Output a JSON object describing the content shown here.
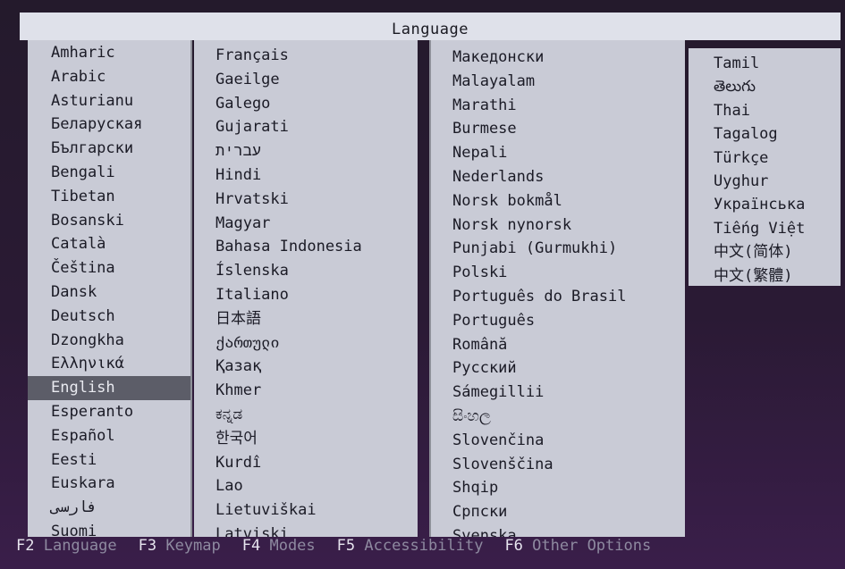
{
  "dialog": {
    "title": "Language"
  },
  "columns": [
    [
      "Amharic",
      "Arabic",
      "Asturianu",
      "Беларуская",
      "Български",
      "Bengali",
      "Tibetan",
      "Bosanski",
      "Català",
      "Čeština",
      "Dansk",
      "Deutsch",
      "Dzongkha",
      "Ελληνικά",
      "English",
      "Esperanto",
      "Español",
      "Eesti",
      "Euskara",
      "فارسی",
      "Suomi"
    ],
    [
      "Français",
      "Gaeilge",
      "Galego",
      "Gujarati",
      "עברית",
      "Hindi",
      "Hrvatski",
      "Magyar",
      "Bahasa Indonesia",
      "Íslenska",
      "Italiano",
      "日本語",
      "ქართული",
      "Қазақ",
      "Khmer",
      "ಕನ್ನಡ",
      "한국어",
      "Kurdî",
      "Lao",
      "Lietuviškai",
      "Latviski"
    ],
    [
      "Македонски",
      "Malayalam",
      "Marathi",
      "Burmese",
      "Nepali",
      "Nederlands",
      "Norsk bokmål",
      "Norsk nynorsk",
      "Punjabi (Gurmukhi)",
      "Polski",
      "Português do Brasil",
      "Português",
      "Română",
      "Русский",
      "Sámegillii",
      "සිංහල",
      "Slovenčina",
      "Slovenščina",
      "Shqip",
      "Српски",
      "Svenska"
    ],
    [
      "Tamil",
      "తెలుగు",
      "Thai",
      "Tagalog",
      "Türkçe",
      "Uyghur",
      "Українська",
      "Tiếng Việt",
      "中文(简体)",
      "中文(繁體)"
    ]
  ],
  "selected": "English",
  "footer": [
    {
      "key": "F2",
      "label": "Language"
    },
    {
      "key": "F3",
      "label": "Keymap"
    },
    {
      "key": "F4",
      "label": "Modes"
    },
    {
      "key": "F5",
      "label": "Accessibility"
    },
    {
      "key": "F6",
      "label": "Other Options"
    }
  ]
}
